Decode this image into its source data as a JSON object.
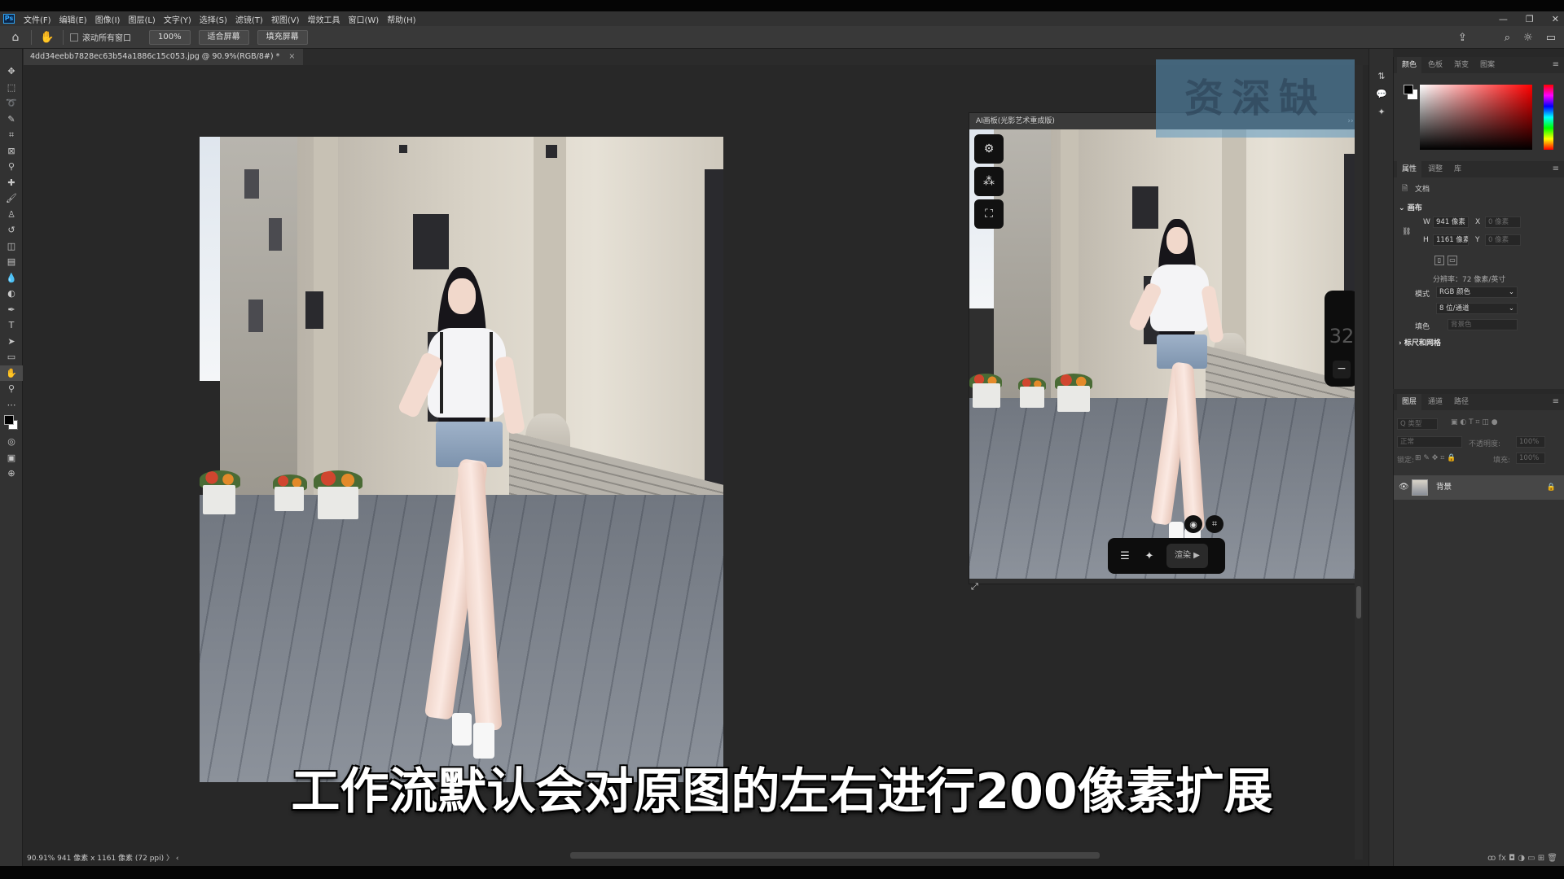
{
  "app": {
    "logo": "Ps",
    "menu": [
      "文件(F)",
      "编辑(E)",
      "图像(I)",
      "图层(L)",
      "文字(Y)",
      "选择(S)",
      "滤镜(T)",
      "视图(V)",
      "增效工具",
      "窗口(W)",
      "帮助(H)"
    ],
    "window_controls": [
      "—",
      "❐",
      "✕"
    ]
  },
  "options": {
    "scroll_all_label": "滚动所有窗口",
    "zoom": "100%",
    "fit_screen": "适合屏幕",
    "fill_screen": "填充屏幕"
  },
  "document": {
    "tab_title": "4dd34eebb7828ec63b54a1886c15c053.jpg @ 90.9%(RGB/8#) *",
    "tab_close": "×"
  },
  "status": {
    "text": "90.91%  941 像素 x 1161 像素 (72 ppi)  〉  ‹"
  },
  "preview_panel": {
    "title": "AI画板(光影艺术重成版)",
    "title_icons": "››  ≡",
    "zoom_value": "32",
    "zoom_minus": "−",
    "render_label": "渲染 ▶"
  },
  "watermark": "资深缺",
  "subtitle": "工作流默认会对原图的左右进行200像素扩展",
  "color_panel": {
    "tabs": [
      "颜色",
      "色板",
      "渐变",
      "图案"
    ]
  },
  "properties_panel": {
    "tabs": [
      "属性",
      "调整",
      "库"
    ],
    "doc_label": "文档",
    "canvas_section": "画布",
    "w_label": "W",
    "w_value": "941 像素",
    "x_label": "X",
    "x_value": "0 像素",
    "h_label": "H",
    "h_value": "1161 像素",
    "y_label": "Y",
    "y_value": "0 像素",
    "resolution": "分辨率：72 像素/英寸",
    "mode_label": "模式",
    "mode_value": "RGB 颜色",
    "bits_value": "8 位/通道",
    "fill_label": "填色",
    "fill_value": "背景色",
    "rulers_section": "标尺和网格"
  },
  "layers_panel": {
    "tabs": [
      "图层",
      "通道",
      "路径"
    ],
    "search_placeholder": "Q 类型",
    "blend_mode": "正常",
    "opacity_label": "不透明度:",
    "opacity_value": "100%",
    "lock_label": "锁定:",
    "fill_label": "填充:",
    "fill_value": "100%",
    "layer_name": "背景",
    "footer_icons": "ꝏ fx ◘ ◑ ▭ ⊞ 🗑"
  }
}
